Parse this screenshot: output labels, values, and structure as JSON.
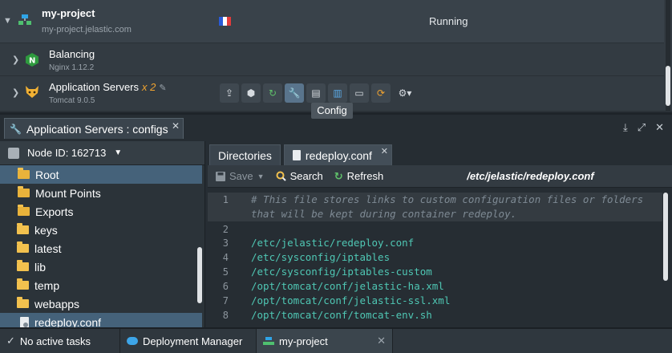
{
  "environment": {
    "name": "my-project",
    "url": "my-project.jelastic.com",
    "status": "Running",
    "region_flag": "france-flag",
    "nodes": [
      {
        "name": "Balancing",
        "version": "Nginx 1.12.2",
        "icon": "nginx-icon",
        "count": ""
      },
      {
        "name": "Application Servers",
        "version": "Tomcat 9.0.5",
        "icon": "tomcat-icon",
        "count": "x 2"
      }
    ],
    "tooltip": "Config"
  },
  "panel": {
    "tab_title": "Application Servers : configs",
    "node_id": "Node ID: 162713",
    "tree": [
      {
        "label": "Root",
        "type": "folder-open",
        "selected": true
      },
      {
        "label": "Mount Points",
        "type": "folder-open",
        "selected": false
      },
      {
        "label": "Exports",
        "type": "folder-open",
        "selected": false
      },
      {
        "label": "keys",
        "type": "folder",
        "selected": false
      },
      {
        "label": "latest",
        "type": "folder",
        "selected": false
      },
      {
        "label": "lib",
        "type": "folder",
        "selected": false
      },
      {
        "label": "temp",
        "type": "folder",
        "selected": false
      },
      {
        "label": "webapps",
        "type": "folder",
        "selected": false
      },
      {
        "label": "redeploy.conf",
        "type": "file",
        "selected": true
      }
    ],
    "editor_tabs": {
      "directories": "Directories",
      "file": "redeploy.conf"
    },
    "toolbar": {
      "save": "Save",
      "search": "Search",
      "refresh": "Refresh",
      "path": "/etc/jelastic/redeploy.conf"
    },
    "code_lines": [
      {
        "n": "1",
        "text": "# This file stores links to custom configuration files or folders",
        "comment": true
      },
      {
        "n": "",
        "text": "that will be kept during container redeploy.",
        "comment": true
      },
      {
        "n": "2",
        "text": "",
        "comment": false
      },
      {
        "n": "3",
        "text": "/etc/jelastic/redeploy.conf",
        "comment": false
      },
      {
        "n": "4",
        "text": "/etc/sysconfig/iptables",
        "comment": false
      },
      {
        "n": "5",
        "text": "/etc/sysconfig/iptables-custom",
        "comment": false
      },
      {
        "n": "6",
        "text": "/opt/tomcat/conf/jelastic-ha.xml",
        "comment": false
      },
      {
        "n": "7",
        "text": "/opt/tomcat/conf/jelastic-ssl.xml",
        "comment": false
      },
      {
        "n": "8",
        "text": "/opt/tomcat/conf/tomcat-env.sh",
        "comment": false
      }
    ]
  },
  "bottom_bar": {
    "tasks": "No active tasks",
    "deployment_manager": "Deployment Manager",
    "project_tab": "my-project"
  },
  "colors": {
    "accent": "#45627a",
    "code_path": "#4fc7b4",
    "count": "#f0a330"
  }
}
